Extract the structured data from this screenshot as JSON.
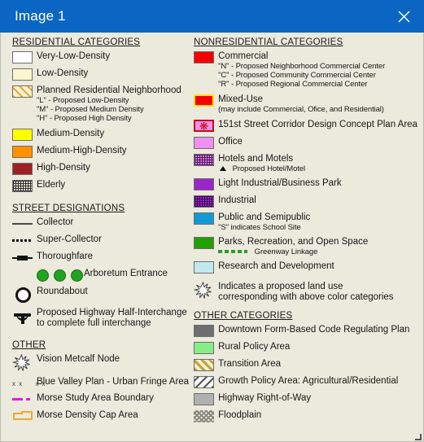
{
  "window": {
    "title": "Image 1",
    "close_label": "close-icon",
    "titlebar_color": "#0b66c3",
    "body_color": "#ece9dd"
  },
  "left_column": {
    "residential": {
      "heading": "RESIDENTIAL CATEGORIES",
      "items": [
        {
          "label": "Very-Low-Density",
          "color": "#ffffff",
          "symbol": "swatch"
        },
        {
          "label": "Low-Density",
          "color": "#fbf6cf",
          "symbol": "swatch"
        },
        {
          "label": "Planned Residential Neighborhood",
          "color": "#fcf4cf",
          "symbol": "swatch-hatch",
          "sublines": [
            "\"L\" - Proposed Low-Density",
            "\"M\" - Proposed Medium Density",
            "\"H\" - Proposed High Density"
          ]
        },
        {
          "label": "Medium-Density",
          "color": "#ffff00",
          "symbol": "swatch"
        },
        {
          "label": "Medium-High-Density",
          "color": "#ff9000",
          "symbol": "swatch"
        },
        {
          "label": "High-Density",
          "color": "#9e2020",
          "symbol": "swatch"
        },
        {
          "label": "Elderly",
          "color": "#efe9d8",
          "symbol": "swatch-grid"
        }
      ]
    },
    "street": {
      "heading": "STREET DESIGNATIONS",
      "items": [
        {
          "label": "Collector",
          "symbol": "solid-line"
        },
        {
          "label": "Super-Collector",
          "symbol": "dashed-line"
        },
        {
          "label": "Thoroughfare",
          "symbol": "thoroughfare-line"
        },
        {
          "label": "Arboretum Entrance",
          "symbol": "three-green-dots",
          "color": "#22a322"
        },
        {
          "label": "Roundabout",
          "symbol": "roundabout-circle"
        },
        {
          "label": "Proposed Highway Half-Interchange",
          "symbol": "interchange-symbol",
          "sublines": [
            "to complete full interchange"
          ]
        }
      ]
    },
    "other": {
      "heading": "OTHER",
      "items": [
        {
          "label": "Vision Metcalf Node",
          "symbol": "starburst"
        },
        {
          "label": "Blue Valley Plan - Urban Fringe Area",
          "symbol": "xx-line"
        },
        {
          "label": "Morse Study Area Boundary",
          "symbol": "magenta-dash-line",
          "color": "#e01ce0"
        },
        {
          "label": "Morse Density Cap Area",
          "symbol": "orange-outline-shape",
          "color": "#f0a830"
        }
      ]
    }
  },
  "right_column": {
    "nonresidential": {
      "heading": "NONRESIDENTIAL CATEGORIES",
      "items": [
        {
          "label": "Commercial",
          "color": "#f40000",
          "symbol": "swatch",
          "sublines": [
            "\"N\" - Proposed Neighborhood Commercial Center",
            "\"C\" - Proposed Community Commercial Center",
            "\"R\" - Proposed Regional Commercial Center"
          ]
        },
        {
          "label": "Mixed-Use",
          "color": "#f40000",
          "border_color": "#ffe400",
          "symbol": "swatch-yellow-border",
          "sublines": [
            "(may include Commercial, Ofice, and Residential)"
          ]
        },
        {
          "label": "151st Street Corridor Design Concept Plan Area",
          "color": "#ef8fef",
          "border_color": "#c01010",
          "symbol": "swatch-red-border-star"
        },
        {
          "label": "Office",
          "color": "#ef8fef",
          "symbol": "swatch"
        },
        {
          "label": "Hotels and Motels",
          "color": "#c878c8",
          "symbol": "swatch-grid",
          "sublines": [
            "Proposed Hotel/Motel"
          ],
          "subline_icon": "triangle-icon"
        },
        {
          "label": "Light Industrial/Business Park",
          "color": "#9b25c9",
          "symbol": "swatch"
        },
        {
          "label": "Industrial",
          "color": "#9b25c9",
          "symbol": "swatch-grid"
        },
        {
          "label": "Public and Semipublic",
          "color": "#119bd6",
          "symbol": "swatch",
          "sublines": [
            "\"S\" indicates School Site"
          ]
        },
        {
          "label": "Parks, Recreation, and Open Space",
          "color": "#22a000",
          "symbol": "swatch",
          "sublines": [
            "Greenway Linkage"
          ],
          "subline_icon": "green-dotted-line"
        },
        {
          "label": "Research and Development",
          "color": "#bfe9ef",
          "symbol": "swatch"
        },
        {
          "label": "Indicates a proposed land use",
          "symbol": "starburst",
          "sublines": [
            "corresponding with above color categories"
          ]
        }
      ]
    },
    "other_categories": {
      "heading": "OTHER CATEGORIES",
      "items": [
        {
          "label": "Downtown Form-Based Code Regulating Plan",
          "color": "#6e6e6e",
          "symbol": "swatch"
        },
        {
          "label": "Rural Policy Area",
          "color": "#85ef85",
          "symbol": "swatch"
        },
        {
          "label": "Transition Area",
          "color": "#f6f0c8",
          "symbol": "swatch-diag-hatch"
        },
        {
          "label": "Growth Policy Area: Agricultural/Residential",
          "color": "#ffffff",
          "symbol": "swatch-diag-hatch-dark"
        },
        {
          "label": "Highway Right-of-Way",
          "color": "#b0b0b0",
          "symbol": "swatch"
        },
        {
          "label": "Floodplain",
          "color": "#f2efe4",
          "symbol": "swatch-crosshatch-soft"
        }
      ]
    }
  }
}
